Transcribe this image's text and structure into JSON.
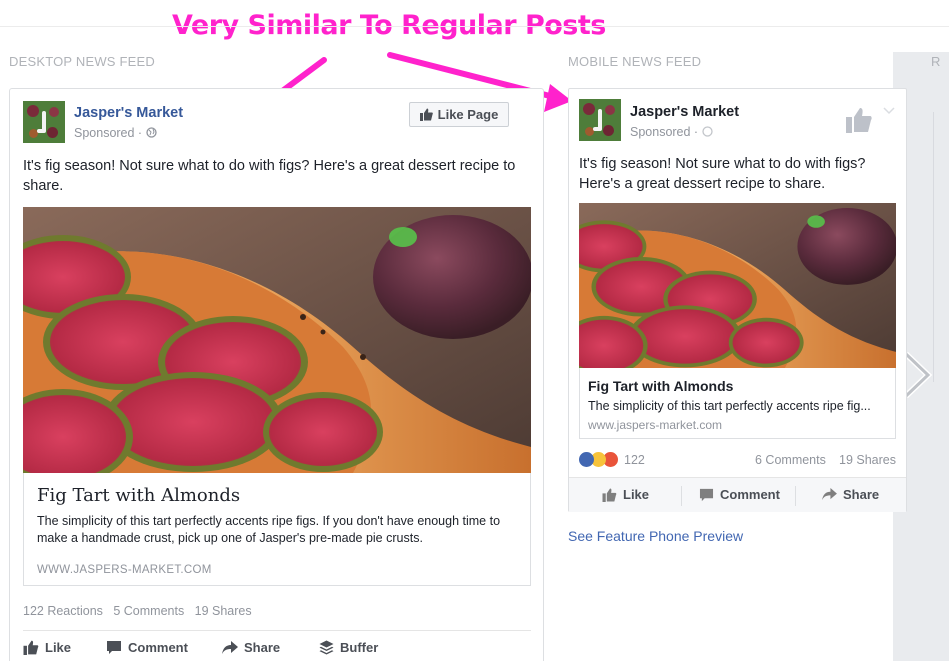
{
  "annotation": {
    "text": "Very Similar To Regular Posts",
    "color": "#ff22cc"
  },
  "sections": {
    "desktop_label": "DESKTOP NEWS FEED",
    "mobile_label": "MOBILE NEWS FEED",
    "right_label": "R"
  },
  "desktop": {
    "page_name": "Jasper's Market",
    "sponsored": "Sponsored · ",
    "like_page": "Like Page",
    "post_text": "It's fig season! Not sure what to do with figs? Here's a great dessert recipe to share.",
    "link_title": "Fig Tart with Almonds",
    "link_desc": "The simplicity of this tart perfectly accents ripe figs. If you don't have enough time to make a handmade crust, pick up one of Jasper's pre-made pie crusts.",
    "link_domain": "WWW.JASPERS-MARKET.COM",
    "reactions": "122 Reactions",
    "comments": "5 Comments",
    "shares": "19 Shares",
    "actions": {
      "like": "Like",
      "comment": "Comment",
      "share": "Share",
      "buffer": "Buffer"
    }
  },
  "mobile": {
    "page_name": "Jasper's Market",
    "sponsored": "Sponsored · ",
    "post_text": "It's fig season! Not sure what to do with figs? Here's a great dessert recipe to share.",
    "link_title": "Fig Tart with Almonds",
    "link_desc": "The simplicity of this tart perfectly accents ripe fig...",
    "link_domain": "www.jaspers-market.com",
    "reaction_count": "122",
    "comments": "6 Comments",
    "shares": "19 Shares",
    "actions": {
      "like": "Like",
      "comment": "Comment",
      "share": "Share"
    },
    "feature_phone_link": "See Feature Phone Preview"
  },
  "colors": {
    "brand_blue": "#365899",
    "link_blue": "#4267b2",
    "muted": "#90949c"
  }
}
